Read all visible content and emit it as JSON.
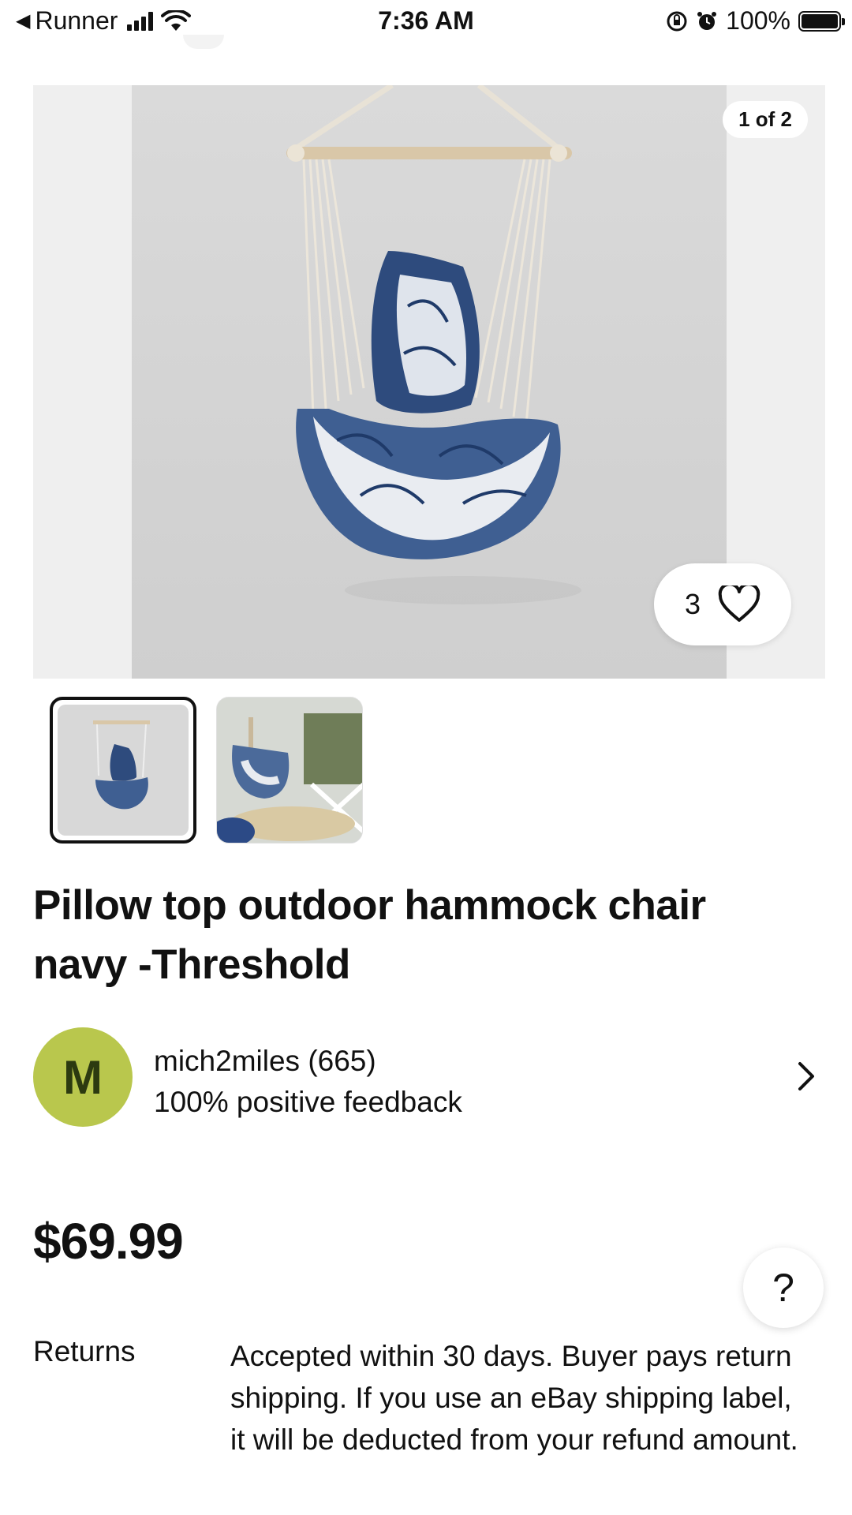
{
  "status_bar": {
    "back_app": "Runner",
    "time": "7:36 AM",
    "battery": "100%",
    "battery_level": 1.0
  },
  "gallery": {
    "counter": "1 of 2",
    "watch_count": "3",
    "images": [
      {
        "icon": "hammock-chair-product-photo"
      },
      {
        "icon": "hammock-chair-lifestyle-photo"
      }
    ],
    "selected_index": 0
  },
  "listing": {
    "title": "Pillow top outdoor hammock chair navy -Threshold",
    "price": "$69.99"
  },
  "seller": {
    "initial": "M",
    "name": "mich2miles (665)",
    "feedback": "100% positive feedback",
    "avatar_color": "#b9c74d"
  },
  "returns": {
    "label": "Returns",
    "text": "Accepted within 30 days. Buyer pays return shipping. If you use an eBay shipping label, it will be deducted from your refund amount."
  },
  "help": {
    "label": "?"
  }
}
